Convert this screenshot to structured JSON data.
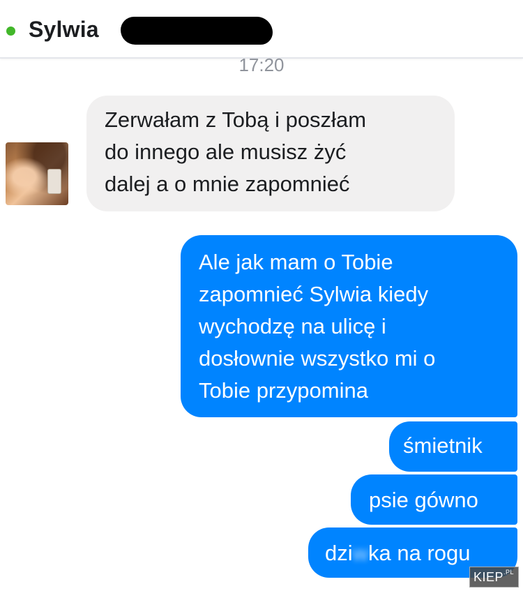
{
  "header": {
    "contact_name": "Sylwia",
    "online": true
  },
  "timestamp": "17:20",
  "messages": [
    {
      "direction": "incoming",
      "lines": [
        "Zerwałam z Tobą i poszłam",
        "do innego ale musisz żyć",
        "dalej a o mnie zapomnieć"
      ]
    },
    {
      "direction": "outgoing",
      "lines": [
        "Ale jak mam o Tobie",
        "zapomnieć Sylwia kiedy",
        "wychodzę na ulicę i",
        "dosłownie wszystko mi o",
        "Tobie przypomina"
      ]
    },
    {
      "direction": "outgoing",
      "lines": [
        "śmietnik"
      ]
    },
    {
      "direction": "outgoing",
      "lines": [
        "psie gówno"
      ]
    },
    {
      "direction": "outgoing",
      "text_start": "dzi",
      "text_blurred": "w",
      "text_end": "ka na rogu"
    }
  ],
  "watermark": {
    "text": "KIEP",
    "suffix": ".PL"
  },
  "colors": {
    "outgoing_bubble": "#0084ff",
    "incoming_bubble": "#f1f0f0",
    "online_dot": "#42b72a"
  }
}
